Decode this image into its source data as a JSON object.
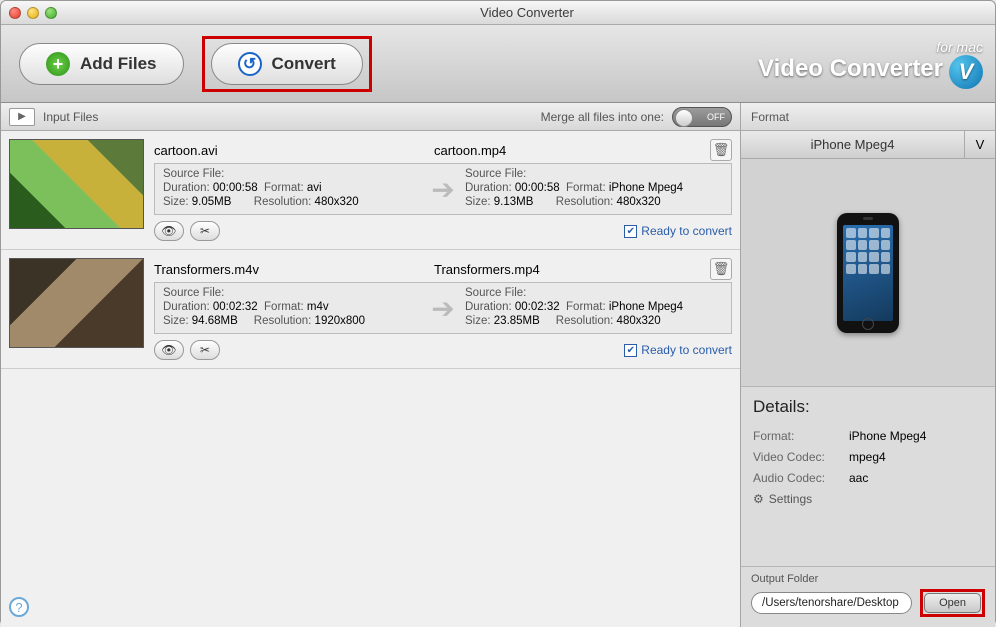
{
  "window": {
    "title": "Video Converter"
  },
  "toolbar": {
    "add_files": "Add Files",
    "convert": "Convert"
  },
  "brand": {
    "line1": "for mac",
    "line2": "Video Converter",
    "badge": "V"
  },
  "list_header": {
    "label": "Input Files",
    "merge_label": "Merge all files into one:",
    "toggle_state": "OFF"
  },
  "items": [
    {
      "src_name": "cartoon.avi",
      "dst_name": "cartoon.mp4",
      "src": {
        "file_label": "Source File:",
        "duration_k": "Duration:",
        "duration_v": "00:00:58",
        "format_k": "Format:",
        "format_v": "avi",
        "size_k": "Size:",
        "size_v": "9.05MB",
        "res_k": "Resolution:",
        "res_v": "480x320"
      },
      "dst": {
        "file_label": "Source File:",
        "duration_k": "Duration:",
        "duration_v": "00:00:58",
        "format_k": "Format:",
        "format_v": "iPhone Mpeg4",
        "size_k": "Size:",
        "size_v": "9.13MB",
        "res_k": "Resolution:",
        "res_v": "480x320"
      },
      "ready_label": "Ready to convert"
    },
    {
      "src_name": "Transformers.m4v",
      "dst_name": "Transformers.mp4",
      "src": {
        "file_label": "Source File:",
        "duration_k": "Duration:",
        "duration_v": "00:02:32",
        "format_k": "Format:",
        "format_v": "m4v",
        "size_k": "Size:",
        "size_v": "94.68MB",
        "res_k": "Resolution:",
        "res_v": "1920x800"
      },
      "dst": {
        "file_label": "Source File:",
        "duration_k": "Duration:",
        "duration_v": "00:02:32",
        "format_k": "Format:",
        "format_v": "iPhone Mpeg4",
        "size_k": "Size:",
        "size_v": "23.85MB",
        "res_k": "Resolution:",
        "res_v": "480x320"
      },
      "ready_label": "Ready to convert"
    }
  ],
  "right": {
    "header": "Format",
    "tab_main": "iPhone Mpeg4",
    "tab_side": "V",
    "details_title": "Details:",
    "format_k": "Format:",
    "format_v": "iPhone Mpeg4",
    "vcodec_k": "Video Codec:",
    "vcodec_v": "mpeg4",
    "acodec_k": "Audio Codec:",
    "acodec_v": "aac",
    "settings": "Settings",
    "out_label": "Output Folder",
    "out_path": "/Users/tenorshare/Desktop",
    "open": "Open"
  }
}
